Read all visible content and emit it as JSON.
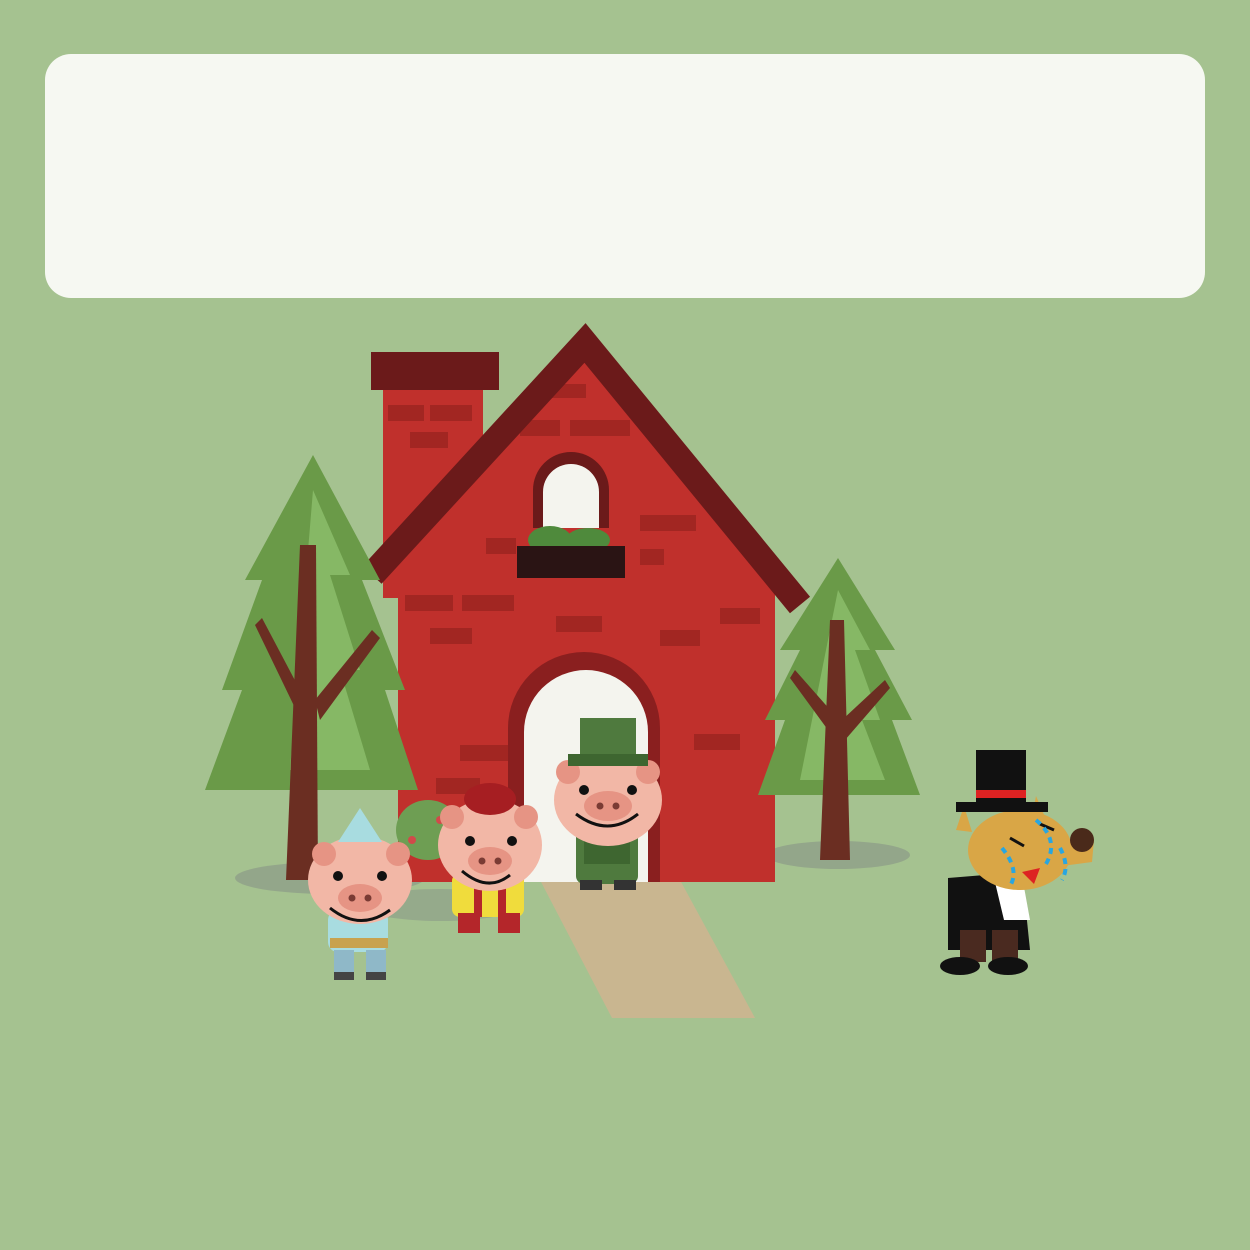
{
  "scene": {
    "background_color": "#a5c290",
    "panel_color": "#f6f8f2",
    "panel_text": "",
    "brick_color": "#c0302c",
    "roof_color": "#6b1a1a",
    "tree_color": "#6a9a48",
    "trunk_color": "#6b2e22",
    "path_color": "#c9b690"
  },
  "characters": [
    {
      "name": "pig-blue-hat"
    },
    {
      "name": "pig-red-hat"
    },
    {
      "name": "pig-green-hat"
    },
    {
      "name": "wolf-top-hat"
    }
  ]
}
